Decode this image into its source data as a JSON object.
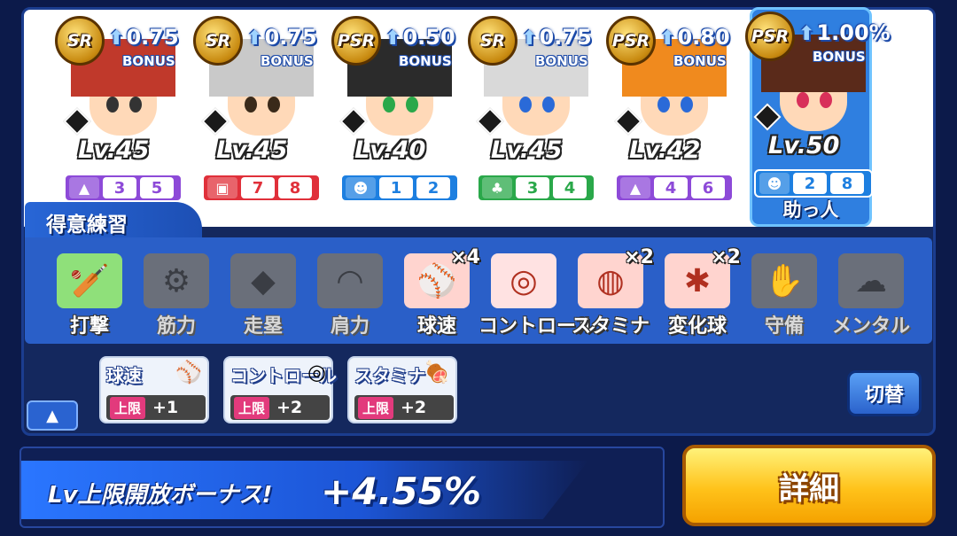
{
  "cards": [
    {
      "rarity": "SR",
      "bonus": "0.75",
      "bonus_label": "BONUS",
      "level": "Lv.45",
      "type_icon": "tree-icon",
      "type_color": "#8d4ad8",
      "stats": [
        "3",
        "5"
      ],
      "hair": "#c0392b",
      "eye": "#333"
    },
    {
      "rarity": "SR",
      "bonus": "0.75",
      "bonus_label": "BONUS",
      "level": "Lv.45",
      "type_icon": "gift-icon",
      "type_color": "#e0303a",
      "stats": [
        "7",
        "8"
      ],
      "hair": "#c9c9c9",
      "eye": "#3a2a1a"
    },
    {
      "rarity": "PSR",
      "bonus": "0.50",
      "bonus_label": "BONUS",
      "level": "Lv.40",
      "type_icon": "robot-icon",
      "type_color": "#1d7fe0",
      "stats": [
        "1",
        "2"
      ],
      "hair": "#2b2b2b",
      "eye": "#2aa84a"
    },
    {
      "rarity": "SR",
      "bonus": "0.75",
      "bonus_label": "BONUS",
      "level": "Lv.45",
      "type_icon": "plant-icon",
      "type_color": "#2aa84a",
      "stats": [
        "3",
        "4"
      ],
      "hair": "#d9d9d9",
      "eye": "#2a6ad8"
    },
    {
      "rarity": "PSR",
      "bonus": "0.80",
      "bonus_label": "BONUS",
      "level": "Lv.42",
      "type_icon": "tree-icon",
      "type_color": "#8d4ad8",
      "stats": [
        "4",
        "6"
      ],
      "hair": "#f08a1e",
      "eye": "#2a6ad8"
    },
    {
      "rarity": "PSR",
      "bonus": "1.00%",
      "bonus_label": "BONUS",
      "level": "Lv.50",
      "type_icon": "robot-icon",
      "type_color": "#1d7fe0",
      "stats": [
        "2",
        "8"
      ],
      "hair": "#5a2a1a",
      "eye": "#d8305a",
      "helper": "助っ人"
    }
  ],
  "tokui_label": "得意練習",
  "practices": [
    {
      "label": "打撃",
      "icon": "bat-icon",
      "active": true,
      "mult": ""
    },
    {
      "label": "筋力",
      "icon": "dumbbell-icon",
      "active": false,
      "mult": ""
    },
    {
      "label": "走塁",
      "icon": "base-icon",
      "active": false,
      "mult": ""
    },
    {
      "label": "肩力",
      "icon": "arm-icon",
      "active": false,
      "mult": ""
    },
    {
      "label": "球速",
      "icon": "fastball-icon",
      "active": true,
      "mult": "×4"
    },
    {
      "label": "コントロール",
      "icon": "target-icon",
      "active": true,
      "mult": ""
    },
    {
      "label": "スタミナ",
      "icon": "tire-icon",
      "active": true,
      "mult": "×2"
    },
    {
      "label": "変化球",
      "icon": "breaking-ball-icon",
      "active": true,
      "mult": "×2"
    },
    {
      "label": "守備",
      "icon": "glove-icon",
      "active": false,
      "mult": ""
    },
    {
      "label": "メンタル",
      "icon": "cloud-icon",
      "active": false,
      "mult": ""
    }
  ],
  "upgrades": [
    {
      "name": "球速",
      "icon": "fastball-icon",
      "limit": "上限",
      "plus": "+1"
    },
    {
      "name": "コントロール",
      "icon": "target-icon",
      "limit": "上限",
      "plus": "+2"
    },
    {
      "name": "スタミナ",
      "icon": "meat-icon",
      "limit": "上限",
      "plus": "+2"
    }
  ],
  "switch_label": "切替",
  "lv_bonus": {
    "title": "Lv上限開放ボーナス!",
    "value": "+4.55%"
  },
  "detail_label": "詳細",
  "colors": {
    "active_tile": "#ffd4cf",
    "inactive_tile": "#6a6f7a",
    "bat_tile": "#8fe07a",
    "target_tile": "#ffe2e2"
  }
}
